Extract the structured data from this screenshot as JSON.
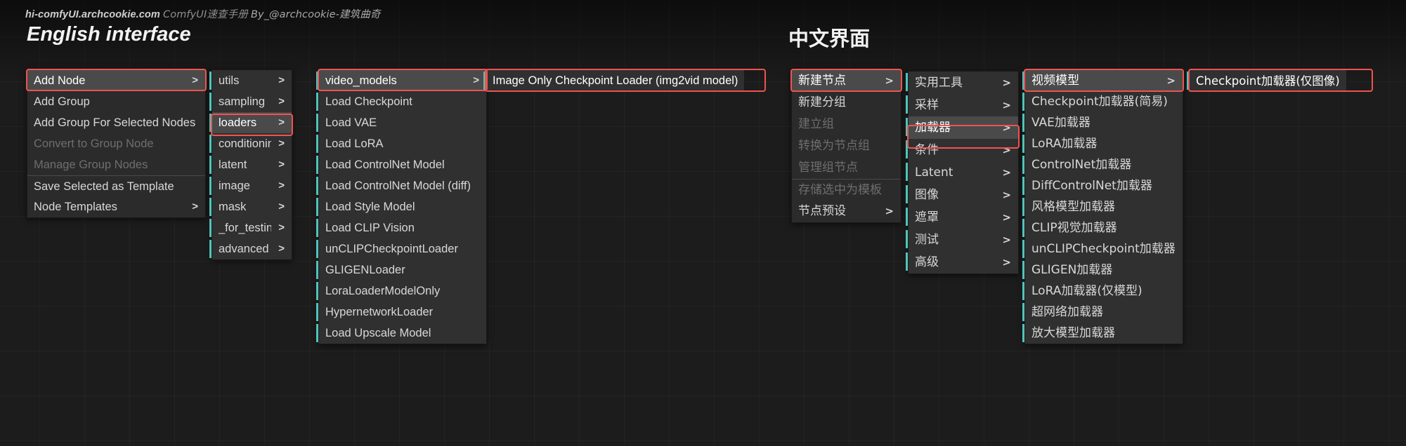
{
  "header": {
    "site": "hi-comfyUI.archcookie.com",
    "subtitle": "ComfyUI速查手册",
    "author": "By_@archcookie-建筑曲奇",
    "title_en": "English interface",
    "title_zh": "中文界面"
  },
  "colors": {
    "highlight_ring": "#ef5350",
    "accent_teal": "#4fc4bd",
    "menu_bg": "#2b2b2b",
    "menu_bg_light": "#303030",
    "text": "#d8d8d8",
    "text_disabled": "#6e6e6e",
    "selected_bg": "#4a4a4a"
  },
  "en": {
    "context_menu": {
      "items": [
        {
          "label": "Add Node",
          "arrow": ">",
          "state": "highlighted"
        },
        {
          "label": "Add Group",
          "arrow": "",
          "state": "normal"
        },
        {
          "label": "Add Group For Selected Nodes",
          "arrow": "",
          "state": "normal"
        },
        {
          "label": "Convert to Group Node",
          "arrow": "",
          "state": "disabled"
        },
        {
          "label": "Manage Group Nodes",
          "arrow": "",
          "state": "disabled"
        },
        {
          "label": "Save Selected as Template",
          "arrow": "",
          "state": "normal",
          "separator_above": true
        },
        {
          "label": "Node Templates",
          "arrow": ">",
          "state": "normal"
        }
      ]
    },
    "categories": {
      "items": [
        {
          "label": "utils",
          "arrow": ">",
          "state": "normal"
        },
        {
          "label": "sampling",
          "arrow": ">",
          "state": "normal"
        },
        {
          "label": "loaders",
          "arrow": ">",
          "state": "selected"
        },
        {
          "label": "conditioning",
          "arrow": ">",
          "state": "normal"
        },
        {
          "label": "latent",
          "arrow": ">",
          "state": "normal"
        },
        {
          "label": "image",
          "arrow": ">",
          "state": "normal"
        },
        {
          "label": "mask",
          "arrow": ">",
          "state": "normal"
        },
        {
          "label": "_for_testing",
          "arrow": ">",
          "state": "normal"
        },
        {
          "label": "advanced",
          "arrow": ">",
          "state": "normal"
        }
      ]
    },
    "loaders": {
      "items": [
        {
          "label": "video_models",
          "arrow": ">",
          "state": "highlighted"
        },
        {
          "label": "Load Checkpoint",
          "arrow": "",
          "state": "normal"
        },
        {
          "label": "Load VAE",
          "arrow": "",
          "state": "normal"
        },
        {
          "label": "Load LoRA",
          "arrow": "",
          "state": "normal"
        },
        {
          "label": "Load ControlNet Model",
          "arrow": "",
          "state": "normal"
        },
        {
          "label": "Load ControlNet Model (diff)",
          "arrow": "",
          "state": "normal"
        },
        {
          "label": "Load Style Model",
          "arrow": "",
          "state": "normal"
        },
        {
          "label": "Load CLIP Vision",
          "arrow": "",
          "state": "normal"
        },
        {
          "label": "unCLIPCheckpointLoader",
          "arrow": "",
          "state": "normal"
        },
        {
          "label": "GLIGENLoader",
          "arrow": "",
          "state": "normal"
        },
        {
          "label": "LoraLoaderModelOnly",
          "arrow": "",
          "state": "normal"
        },
        {
          "label": "HypernetworkLoader",
          "arrow": "",
          "state": "normal"
        },
        {
          "label": "Load Upscale Model",
          "arrow": "",
          "state": "normal"
        }
      ]
    },
    "leaf_node": {
      "label": "Image Only Checkpoint Loader (img2vid model)"
    }
  },
  "zh": {
    "context_menu": {
      "items": [
        {
          "label": "新建节点",
          "arrow": ">",
          "state": "highlighted"
        },
        {
          "label": "新建分组",
          "arrow": "",
          "state": "normal"
        },
        {
          "label": "建立组",
          "arrow": "",
          "state": "disabled"
        },
        {
          "label": "转换为节点组",
          "arrow": "",
          "state": "disabled"
        },
        {
          "label": "管理组节点",
          "arrow": "",
          "state": "disabled"
        },
        {
          "label": "存储选中为模板",
          "arrow": "",
          "state": "disabled",
          "separator_above": true
        },
        {
          "label": "节点预设",
          "arrow": ">",
          "state": "normal"
        }
      ]
    },
    "categories": {
      "items": [
        {
          "label": "实用工具",
          "arrow": ">",
          "state": "normal"
        },
        {
          "label": "采样",
          "arrow": ">",
          "state": "normal"
        },
        {
          "label": "加载器",
          "arrow": ">",
          "state": "selected"
        },
        {
          "label": "条件",
          "arrow": ">",
          "state": "normal"
        },
        {
          "label": "Latent",
          "arrow": ">",
          "state": "normal"
        },
        {
          "label": "图像",
          "arrow": ">",
          "state": "normal"
        },
        {
          "label": "遮罩",
          "arrow": ">",
          "state": "normal"
        },
        {
          "label": "测试",
          "arrow": ">",
          "state": "normal"
        },
        {
          "label": "高级",
          "arrow": ">",
          "state": "normal"
        }
      ]
    },
    "loaders": {
      "items": [
        {
          "label": "视频模型",
          "arrow": ">",
          "state": "highlighted"
        },
        {
          "label": "Checkpoint加载器(简易)",
          "arrow": "",
          "state": "normal"
        },
        {
          "label": "VAE加载器",
          "arrow": "",
          "state": "normal"
        },
        {
          "label": "LoRA加载器",
          "arrow": "",
          "state": "normal"
        },
        {
          "label": "ControlNet加载器",
          "arrow": "",
          "state": "normal"
        },
        {
          "label": "DiffControlNet加载器",
          "arrow": "",
          "state": "normal"
        },
        {
          "label": "风格模型加载器",
          "arrow": "",
          "state": "normal"
        },
        {
          "label": "CLIP视觉加载器",
          "arrow": "",
          "state": "normal"
        },
        {
          "label": "unCLIPCheckpoint加载器",
          "arrow": "",
          "state": "normal"
        },
        {
          "label": "GLIGEN加载器",
          "arrow": "",
          "state": "normal"
        },
        {
          "label": "LoRA加载器(仅模型)",
          "arrow": "",
          "state": "normal"
        },
        {
          "label": "超网络加载器",
          "arrow": "",
          "state": "normal"
        },
        {
          "label": "放大模型加载器",
          "arrow": "",
          "state": "normal"
        }
      ]
    },
    "leaf_node": {
      "label": "Checkpoint加载器(仅图像)"
    }
  }
}
